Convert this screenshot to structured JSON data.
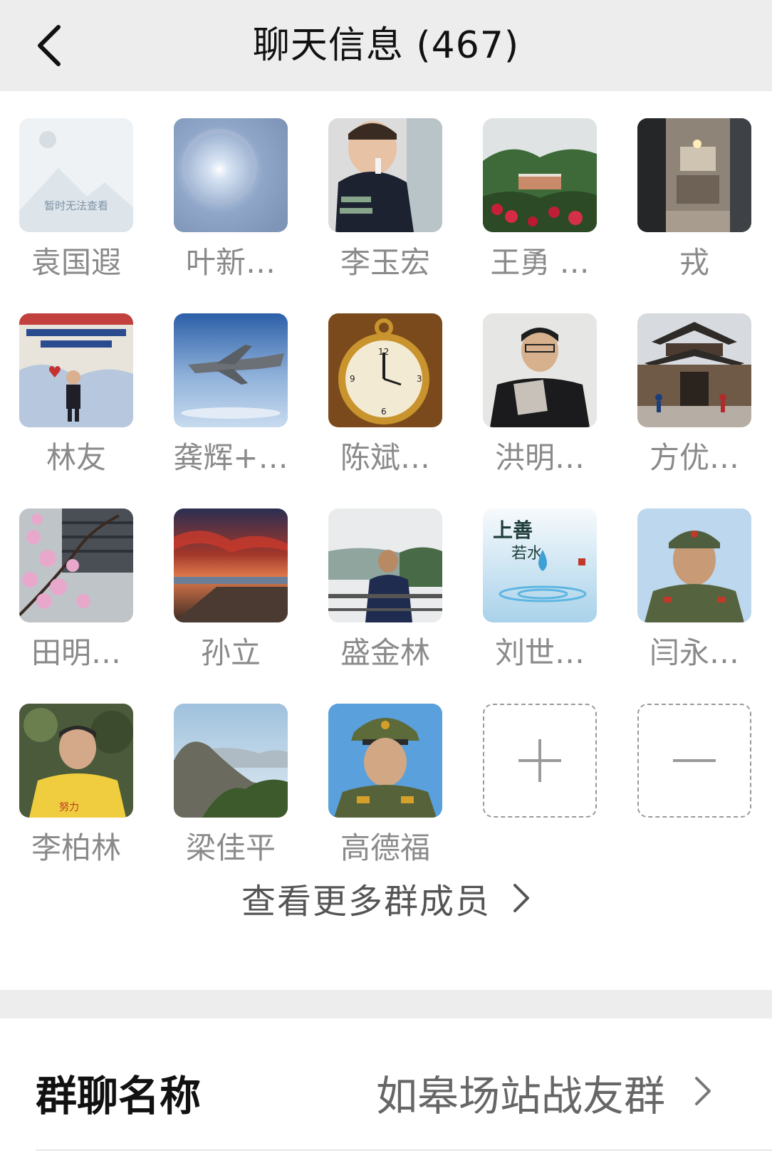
{
  "header": {
    "title": "聊天信息 (467)"
  },
  "members": [
    {
      "name": "袁国遐",
      "avatar_icon": "placeholder-image-icon",
      "placeholder_text": "暂时无法查看"
    },
    {
      "name": "叶新…",
      "avatar_icon": "sun-halo-photo"
    },
    {
      "name": "李玉宏",
      "avatar_icon": "child-photo"
    },
    {
      "name": "王勇 …",
      "avatar_icon": "garden-landscape-photo"
    },
    {
      "name": "戎",
      "avatar_icon": "room-interior-photo"
    },
    {
      "name": "林友",
      "avatar_icon": "child-poster-photo"
    },
    {
      "name": "龚辉+…",
      "avatar_icon": "fighter-jet-photo"
    },
    {
      "name": "陈斌…",
      "avatar_icon": "pocket-watch-photo"
    },
    {
      "name": "洪明…",
      "avatar_icon": "man-reading-photo"
    },
    {
      "name": "方优…",
      "avatar_icon": "temple-gate-photo"
    },
    {
      "name": "田明…",
      "avatar_icon": "blossom-photo"
    },
    {
      "name": "孙立",
      "avatar_icon": "sunset-beach-photo"
    },
    {
      "name": "盛金林",
      "avatar_icon": "man-lakeside-photo"
    },
    {
      "name": "刘世…",
      "avatar_icon": "water-drop-calligraphy"
    },
    {
      "name": "闫永…",
      "avatar_icon": "soldier-portrait-photo"
    },
    {
      "name": "李柏林",
      "avatar_icon": "man-yellow-shirt-photo"
    },
    {
      "name": "梁佳平",
      "avatar_icon": "mountain-photo"
    },
    {
      "name": "高德福",
      "avatar_icon": "officer-portrait-photo"
    }
  ],
  "actions": {
    "add_icon": "plus-icon",
    "remove_icon": "minus-icon"
  },
  "more_members": {
    "label": "查看更多群成员"
  },
  "group_name_row": {
    "label": "群聊名称",
    "value": "如皋场站战友群"
  },
  "colors": {
    "background": "#ededed",
    "panel": "#ffffff",
    "muted_text": "#8a8a8a"
  }
}
